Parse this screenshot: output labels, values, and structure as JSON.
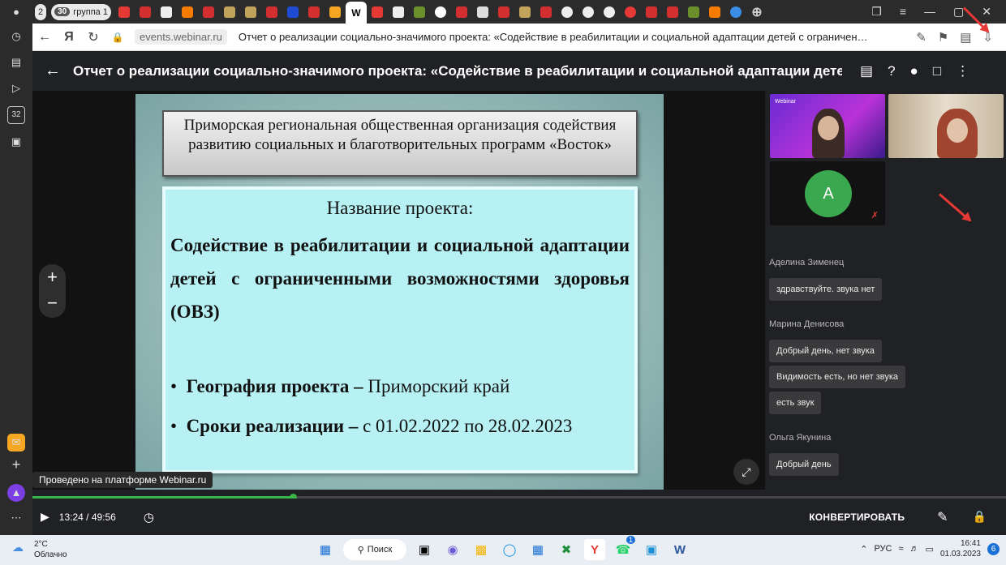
{
  "browser": {
    "tab_group_count": "2",
    "tab_group_badge": "30",
    "tab_group_name": "группа 1",
    "active_tab_letter": "W",
    "url": "events.webinar.ru",
    "page_title": "Отчет о реализации социально-значимого проекта: «Содействие в реабилитации и социальной адаптации детей с ограничен…",
    "sidebar_badge": "32"
  },
  "webinar": {
    "title": "Отчет о реализации социально-значимого проекта: «Содействие в реабилитации и социальной адаптации детей с ограни",
    "platform_tooltip": "Проведено на платформе Webinar.ru",
    "time": "13:24 / 49:56",
    "progress_fraction": 0.268,
    "convert_label": "КОНВЕРТИРОВАТЬ"
  },
  "slide": {
    "org_heading": "Приморская региональная общественная организация содействия развитию социальных и благотворительных программ «Восток»",
    "name_heading": "Название проекта:",
    "project_name": "Содействие в реабилитации и социальной адаптации детей с ограниченными возможностями здоровья (ОВЗ)",
    "geo_label": "География проекта –",
    "geo_value": " Приморский край",
    "dates_label": "Сроки реализации –",
    "dates_value": " с 01.02.2022  по 28.02.2023"
  },
  "participants": {
    "logo_text": "Webinar",
    "avatar_letter": "А"
  },
  "chat": {
    "messages": [
      {
        "author": "Аделина Зименец",
        "texts": [
          "здравствуйте. звука нет"
        ]
      },
      {
        "author": "Марина Денисова",
        "texts": [
          "Добрый день, нет звука",
          "Видимость есть, но нет звука",
          "есть звук"
        ]
      },
      {
        "author": "Ольга Якунина",
        "texts": [
          "Добрый день"
        ]
      }
    ]
  },
  "taskbar": {
    "temperature": "2°C",
    "weather": "Облачно",
    "search_label": "Поиск",
    "language": "РУС",
    "time": "16:41",
    "date": "01.03.2023",
    "notifications": "6",
    "whatsapp_badge": "1"
  }
}
